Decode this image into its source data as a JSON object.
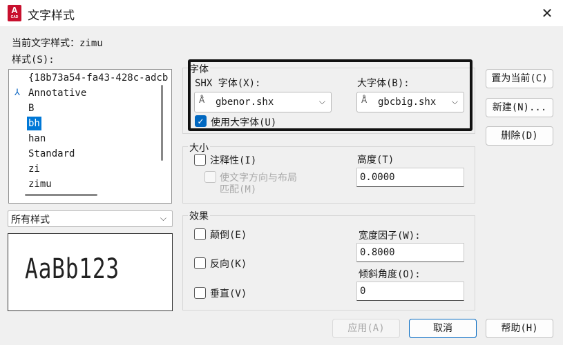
{
  "window": {
    "title": "文字样式",
    "app_icon_letter": "A",
    "app_icon_sub": "CAD"
  },
  "current_style": {
    "label": "当前文字样式：",
    "value": "zimu"
  },
  "styles": {
    "label": "样式(S):",
    "items": [
      {
        "label": "{18b73a54-fa43-428c-adcb",
        "annotative": false,
        "selected": false
      },
      {
        "label": "Annotative",
        "annotative": true,
        "selected": false
      },
      {
        "label": "B",
        "annotative": false,
        "selected": false
      },
      {
        "label": "bh",
        "annotative": false,
        "selected": true
      },
      {
        "label": "han",
        "annotative": false,
        "selected": false
      },
      {
        "label": "Standard",
        "annotative": false,
        "selected": false
      },
      {
        "label": "zi",
        "annotative": false,
        "selected": false
      },
      {
        "label": "zimu",
        "annotative": false,
        "selected": false
      }
    ]
  },
  "filter": {
    "value": "所有样式"
  },
  "preview": {
    "text": "AaBb123"
  },
  "font": {
    "group_title": "字体",
    "shx_label": "SHX 字体(X):",
    "shx_value": "gbenor.shx",
    "big_label": "大字体(B):",
    "big_value": "gbcbig.shx",
    "use_big_label": "使用大字体(U)",
    "use_big_checked": true
  },
  "size": {
    "group_title": "大小",
    "annotative_label": "注释性(I)",
    "match_label_line1": "使文字方向与布局",
    "match_label_line2": "匹配(M)",
    "height_label": "高度(T)",
    "height_value": "0.0000"
  },
  "effects": {
    "group_title": "效果",
    "upside_down_label": "颠倒(E)",
    "backwards_label": "反向(K)",
    "vertical_label": "垂直(V)",
    "width_label": "宽度因子(W):",
    "width_value": "0.8000",
    "oblique_label": "倾斜角度(O):",
    "oblique_value": "0"
  },
  "buttons": {
    "set_current": "置为当前(C)",
    "new": "新建(N)...",
    "delete": "删除(D)",
    "apply": "应用(A)",
    "cancel": "取消",
    "help": "帮助(H)"
  },
  "icons": {
    "close": "close-icon",
    "font": "font-icon",
    "chevron": "chevron-down-icon",
    "check": "check-icon",
    "annotative": "annotative-icon"
  },
  "colors": {
    "selection": "#0078d7",
    "checkbox_on": "#0067c0",
    "app_icon": "#c8102e",
    "highlight_border": "#111111"
  }
}
